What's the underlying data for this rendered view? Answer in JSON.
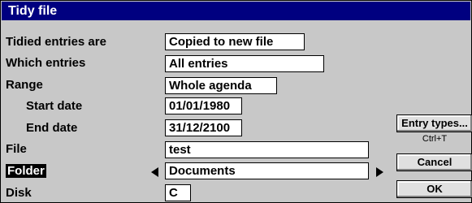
{
  "dialog": {
    "title": "Tidy file"
  },
  "fields": {
    "tidied_label": "Tidied entries are",
    "tidied_value": "Copied to new file",
    "which_label": "Which entries",
    "which_value": "All entries",
    "range_label": "Range",
    "range_value": "Whole agenda",
    "start_label": "Start date",
    "start_value": "01/01/1980",
    "end_label": "End date",
    "end_value": "31/12/2100",
    "file_label": "File",
    "file_value": "test",
    "folder_label": "Folder",
    "folder_value": "Documents",
    "disk_label": "Disk",
    "disk_value": "C"
  },
  "buttons": {
    "entry_types": "Entry types...",
    "entry_types_shortcut": "Ctrl+T",
    "cancel": "Cancel",
    "ok": "OK"
  },
  "colors": {
    "titlebar": "#000080",
    "dialog_bg": "#c8c8c8",
    "field_bg": "#ffffff"
  }
}
